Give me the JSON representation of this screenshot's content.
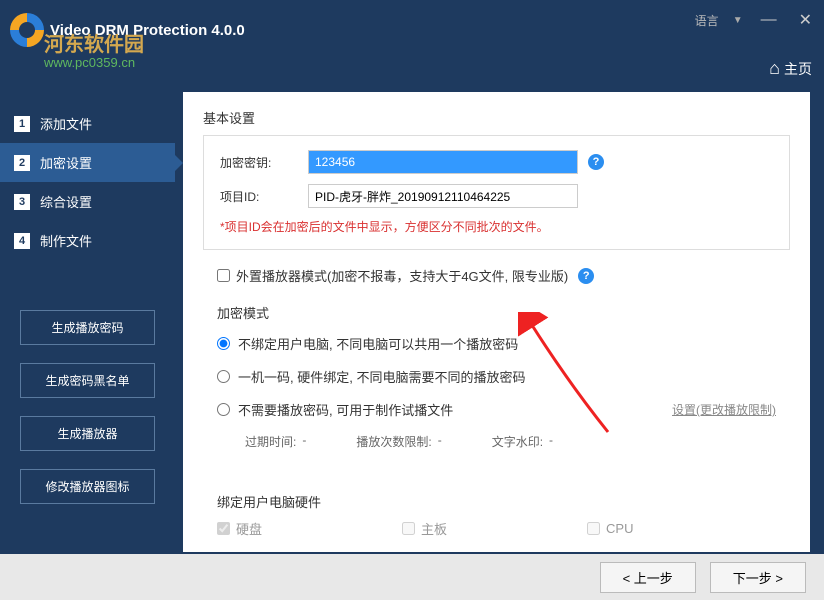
{
  "app": {
    "title": "Video DRM Protection 4.0.0",
    "watermark_cn": "河东软件园",
    "watermark_url": "www.pc0359.cn",
    "language_label": "语言",
    "home_label": "主页"
  },
  "nav": {
    "items": [
      {
        "num": "1",
        "label": "添加文件"
      },
      {
        "num": "2",
        "label": "加密设置"
      },
      {
        "num": "3",
        "label": "综合设置"
      },
      {
        "num": "4",
        "label": "制作文件"
      }
    ],
    "active_index": 1,
    "side_buttons": [
      "生成播放密码",
      "生成密码黑名单",
      "生成播放器",
      "修改播放器图标"
    ]
  },
  "basic": {
    "section_title": "基本设置",
    "key_label": "加密密钥:",
    "key_value": "123456",
    "pid_label": "项目ID:",
    "pid_value": "PID-虎牙-胖炸_20190912110464225",
    "warning": "*项目ID会在加密后的文件中显示，方便区分不同批次的文件。"
  },
  "external": {
    "label": "外置播放器模式(加密不报毒，支持大于4G文件, 限专业版)"
  },
  "mode": {
    "section_title": "加密模式",
    "options": [
      "不绑定用户电脑, 不同电脑可以共用一个播放密码",
      "一机一码, 硬件绑定, 不同电脑需要不同的播放密码",
      "不需要播放密码, 可用于制作试播文件"
    ],
    "selected_index": 0,
    "settings_link": "设置(更改播放限制)",
    "expire_label": "过期时间:",
    "expire_value": "-",
    "play_limit_label": "播放次数限制:",
    "play_limit_value": "-",
    "watermark_label": "文字水印:",
    "watermark_value": "-"
  },
  "bind": {
    "section_title": "绑定用户电脑硬件",
    "disk": "硬盘",
    "board": "主板",
    "cpu": "CPU"
  },
  "footer": {
    "prev": "< 上一步",
    "next": "下一步 >"
  }
}
